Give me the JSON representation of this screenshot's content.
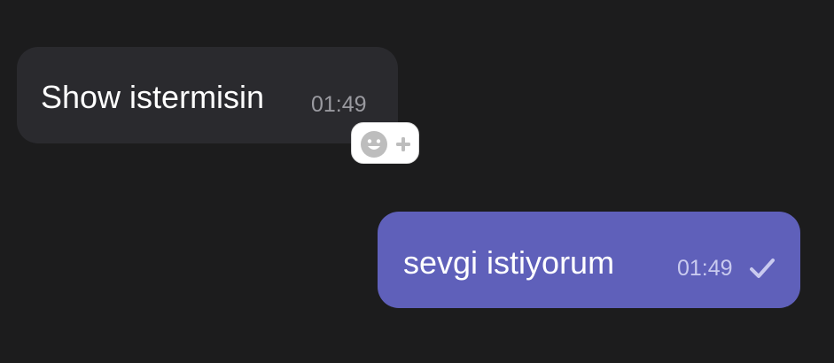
{
  "messages": [
    {
      "direction": "incoming",
      "text": "Show istermisin",
      "time": "01:49"
    },
    {
      "direction": "outgoing",
      "text": "sevgi istiyorum",
      "time": "01:49",
      "status_icon": "check-icon"
    }
  ],
  "reaction_picker": {
    "icons": [
      "smiley-icon",
      "plus-icon"
    ]
  },
  "colors": {
    "background": "#1c1c1d",
    "incoming_bubble": "#2a2a2e",
    "outgoing_bubble": "#5f60ba",
    "message_text": "#ffffff",
    "incoming_time": "#9a9aa0",
    "outgoing_time": "#c9caef",
    "reaction_chip": "#ffffff",
    "reaction_icon": "#bdbdbd"
  }
}
